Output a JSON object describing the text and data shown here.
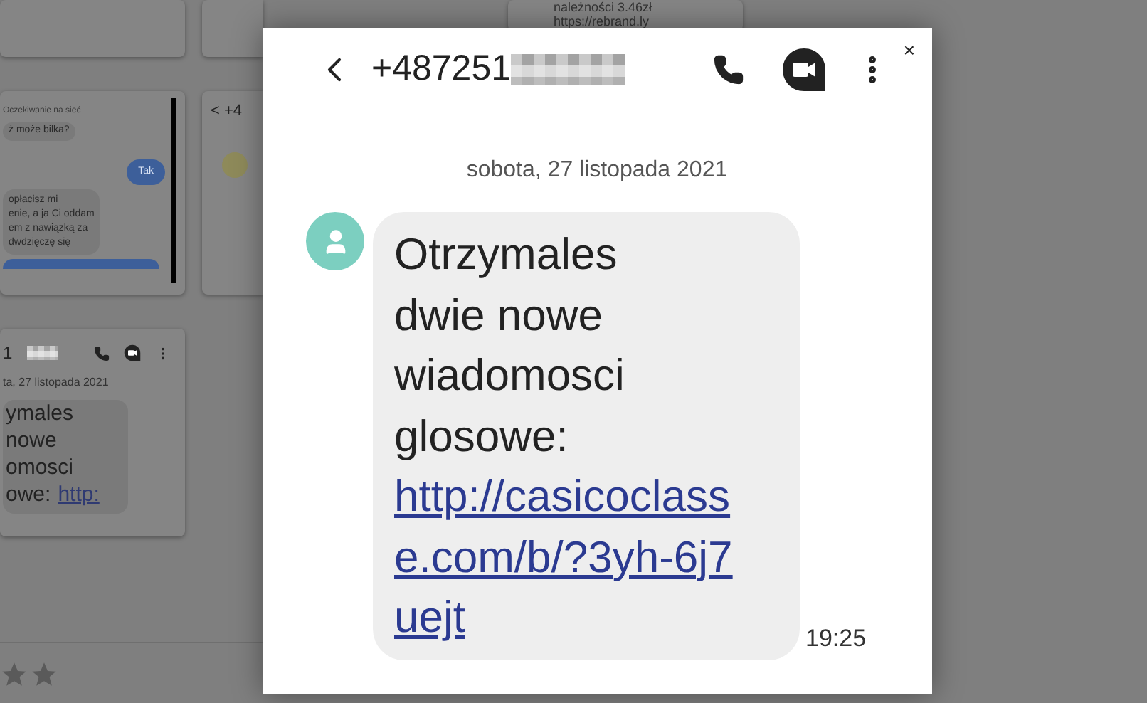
{
  "background": {
    "top_card": {
      "lines": [
        "należności 3.46zł",
        "https://rebrand.ly"
      ]
    },
    "chat_card": {
      "status": "Oczekiwanie na sieć",
      "quoted": "ż może bilka?",
      "reply": "Tak",
      "message": [
        "opłacisz mi",
        "enie, a ja Ci oddam",
        "em z nawiązką za",
        "dwdzięczę się"
      ]
    },
    "contact_card": {
      "number": "< +4"
    },
    "sms_card": {
      "number": "1",
      "date": "ta, 27 listopada 2021",
      "lines": [
        "ymales",
        "nowe",
        "omosci",
        "owe:"
      ],
      "link": "http:"
    },
    "rating": {
      "icons": [
        {
          "kind": "star"
        },
        {
          "kind": "star"
        }
      ]
    }
  },
  "lightbox": {
    "close": "×",
    "conversation": {
      "number": "+487251",
      "date": "sobota, 27 listopada 2021",
      "message": {
        "text": "Otrzymales dwie nowe wiadomosci glosowe:",
        "link": "http://casicoclasse.com/b/?3yh-6j7uejt",
        "time": "19:25"
      }
    }
  }
}
